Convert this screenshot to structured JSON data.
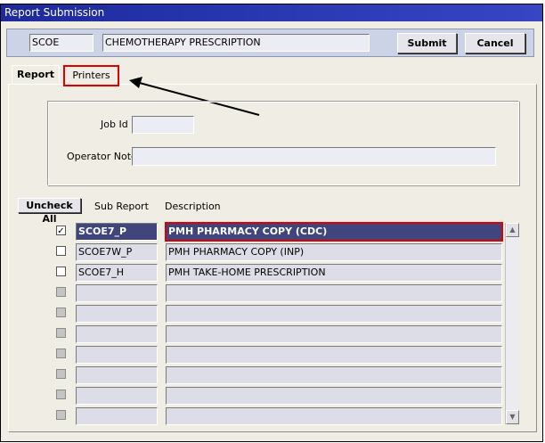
{
  "window": {
    "title": "Report Submission"
  },
  "header": {
    "code": "SCOE",
    "name": "CHEMOTHERAPY PRESCRIPTION",
    "submit_label": "Submit",
    "cancel_label": "Cancel"
  },
  "tabs": [
    {
      "label": "Report",
      "active": true
    },
    {
      "label": "Printers",
      "active": false
    }
  ],
  "form": {
    "job_id_label": "Job Id",
    "job_id_value": "",
    "operator_note_label": "Operator Note",
    "operator_note_value": ""
  },
  "list": {
    "uncheck_all_label": "Uncheck All",
    "col_sub_report": "Sub Report",
    "col_description": "Description",
    "rows": [
      {
        "checked": true,
        "enabled": true,
        "sub_report": "SCOE7_P",
        "description": "PMH PHARMACY COPY (CDC)",
        "selected": true
      },
      {
        "checked": false,
        "enabled": true,
        "sub_report": "SCOE7W_P",
        "description": "PMH PHARMACY COPY (INP)",
        "selected": false
      },
      {
        "checked": false,
        "enabled": true,
        "sub_report": "SCOE7_H",
        "description": "PMH TAKE-HOME PRESCRIPTION",
        "selected": false
      },
      {
        "checked": false,
        "enabled": false,
        "sub_report": "",
        "description": "",
        "selected": false
      },
      {
        "checked": false,
        "enabled": false,
        "sub_report": "",
        "description": "",
        "selected": false
      },
      {
        "checked": false,
        "enabled": false,
        "sub_report": "",
        "description": "",
        "selected": false
      },
      {
        "checked": false,
        "enabled": false,
        "sub_report": "",
        "description": "",
        "selected": false
      },
      {
        "checked": false,
        "enabled": false,
        "sub_report": "",
        "description": "",
        "selected": false
      },
      {
        "checked": false,
        "enabled": false,
        "sub_report": "",
        "description": "",
        "selected": false
      },
      {
        "checked": false,
        "enabled": false,
        "sub_report": "",
        "description": "",
        "selected": false
      }
    ]
  },
  "icons": {
    "check": "checkmark-icon",
    "scroll_up": "scroll-up-arrow-icon",
    "scroll_down": "scroll-down-arrow-icon",
    "annotation": "annotation-arrow-icon"
  },
  "colors": {
    "titlebar": "#1d2a9c",
    "selected_row": "#41457e",
    "highlight": "#e00000"
  }
}
